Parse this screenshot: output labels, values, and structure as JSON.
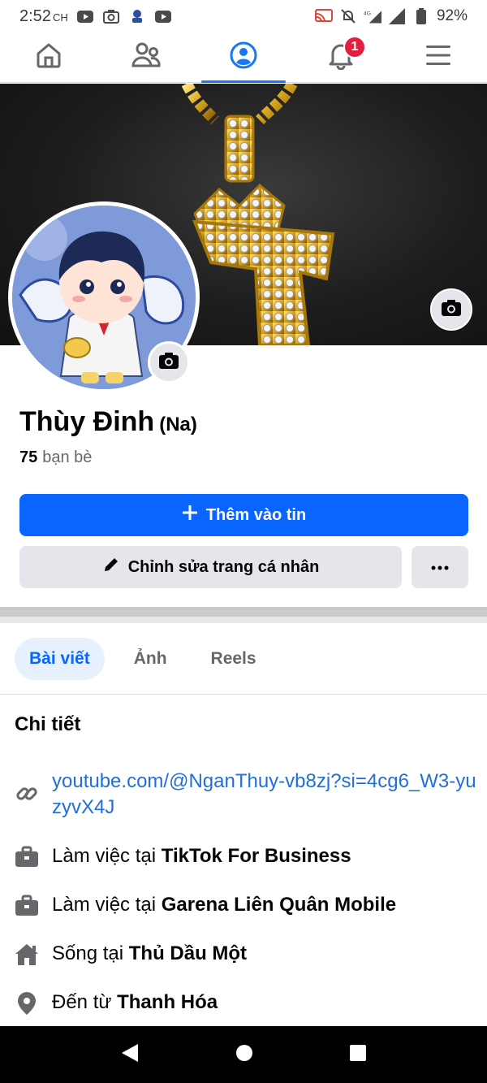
{
  "status_bar": {
    "time": "2:52",
    "time_suffix": "CH",
    "battery": "92%",
    "network": "4G",
    "colors": {
      "text": "#3a3a3a"
    }
  },
  "top_nav": {
    "tabs": [
      {
        "icon": "home-icon"
      },
      {
        "icon": "friends-icon"
      },
      {
        "icon": "profile-icon",
        "active": true
      },
      {
        "icon": "bell-icon",
        "badge": "1"
      },
      {
        "icon": "menu-icon"
      }
    ],
    "accent": "#1877f2"
  },
  "profile": {
    "name": "Thùy Đinh",
    "alternate_name": "(Na)",
    "friends_count": "75",
    "friends_label": "bạn bè"
  },
  "actions": {
    "add_story": "Thêm vào tin",
    "edit_profile": "Chỉnh sửa trang cá nhân",
    "more": "···"
  },
  "profile_tabs": [
    {
      "label": "Bài viết",
      "active": true
    },
    {
      "label": "Ảnh"
    },
    {
      "label": "Reels"
    }
  ],
  "details": {
    "title": "Chi tiết",
    "link": "youtube.com/@NganThuy-vb8zj?si=4cg6_W3-yuzyvX4J",
    "items": [
      {
        "icon": "briefcase-icon",
        "prefix": "Làm việc tại",
        "value": "TikTok For Business"
      },
      {
        "icon": "briefcase-icon",
        "prefix": "Làm việc tại",
        "value": "Garena Liên Quân Mobile"
      },
      {
        "icon": "house-icon",
        "prefix": "Sống tại",
        "value": "Thủ Dầu Một"
      },
      {
        "icon": "location-pin-icon",
        "prefix": "Đến từ",
        "value": "Thanh Hóa"
      }
    ]
  },
  "colors": {
    "primary": "#0866ff",
    "link": "#216fdb",
    "secondary_button": "#e4e6eb",
    "badge": "#e41e3f"
  }
}
